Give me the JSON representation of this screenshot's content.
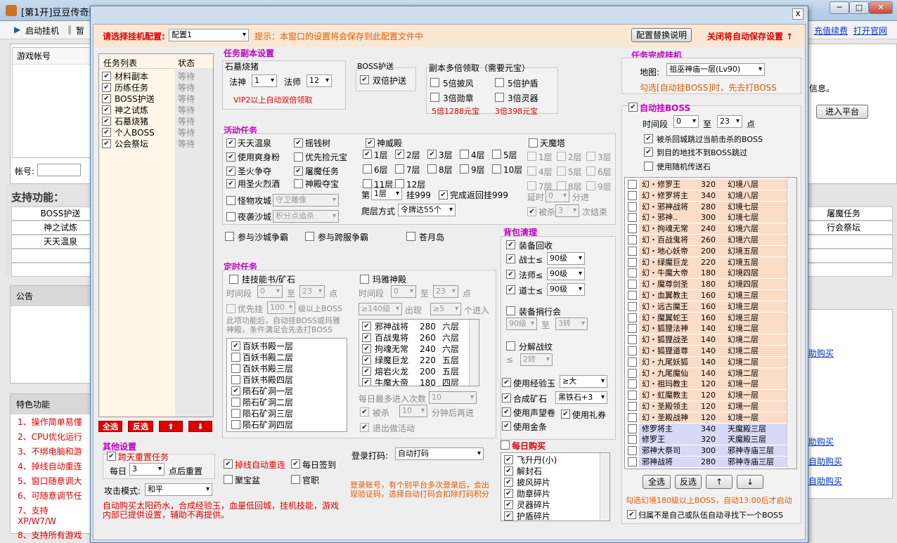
{
  "window": {
    "title": "[第1开]豆豆传奇荣",
    "btn_min": "─",
    "btn_max": "□",
    "btn_close": "✕"
  },
  "toolbar": {
    "start": "启动挂机",
    "pause": "暂",
    "renew": "充值续费",
    "official": "打开官网"
  },
  "main": {
    "account_col": "游戏帐号",
    "account_label": "帐号:",
    "info_text": "息信息。",
    "enter_btn": "进入平台",
    "support_title": "支持功能：",
    "support_cells": [
      "BOSS护送",
      "神之试炼",
      "天天温泉"
    ],
    "support_right": [
      "屠魔任务",
      "行会祭坛"
    ],
    "notice": "公告",
    "special": "特色功能",
    "special_items": [
      "1、操作简单易懂",
      "2、CPU优化运行",
      "3、不绑电脑和游",
      "4、掉线自动重连",
      "5、窗口随意调大",
      "6、可随意调节任",
      "7、支持XP/W7/W",
      "8、支持所有游戏"
    ],
    "buy_links": [
      "助购买",
      "助购买",
      "自助购买",
      "自助购买"
    ]
  },
  "dialog": {
    "close": "x",
    "config_label": "请选择挂机配置:",
    "config_value": "配置1",
    "tip": "提示：本窗口的设置将会保存到此配置文件中",
    "replace_btn": "配置替换说明",
    "close_save": "关闭将自动保存设置 ↑",
    "task_list": {
      "col_task": "任务列表",
      "col_status": "状态",
      "items": [
        {
          "name": "材料副本",
          "status": "等待"
        },
        {
          "name": "历练任务",
          "status": "等待"
        },
        {
          "name": "BOSS护送",
          "status": "等待"
        },
        {
          "name": "神之试炼",
          "status": "等待"
        },
        {
          "name": "石墓烧猪",
          "status": "等待"
        },
        {
          "name": "个人BOSS",
          "status": "等待"
        },
        {
          "name": "公会祭坛",
          "status": "等待"
        }
      ],
      "buttons": [
        "全选",
        "反选",
        "⬆",
        "⬇"
      ]
    },
    "dungeon": {
      "title": "任务副本设置",
      "sub": "石墓烧猪",
      "god_label": "法神",
      "god_value": "1",
      "mage_label": "法师",
      "mage_value": "12",
      "vip_tip": "VIP2以上自动双倍领取",
      "boss_escort": "BOSS护送",
      "double_escort": "双倍护送",
      "multi_title": "副本多倍领取（需要元宝）",
      "x5wind": "5倍披风",
      "x5shield": "5倍护盾",
      "x3medal": "3倍勋章",
      "x3spirit": "3倍灵器",
      "cost5": "5倍1288元宝",
      "cost3": "3倍398元宝"
    },
    "activity": {
      "title": "活动任务",
      "hotspring": "天天温泉",
      "moneytree": "摇钱树",
      "shenwei": "神威殿",
      "tianmo": "天魔塔",
      "shuangshen": "使用爽身粉",
      "youxian": "优先捡元宝",
      "shengzheng": "圣火争夺",
      "tumo": "屠魔任务",
      "yongshenghuo": "用圣火烈酒",
      "zhuodian": "神殿夺宝",
      "floors": [
        "1层",
        "2层",
        "3层",
        "4层",
        "5层",
        "6层",
        "7层",
        "8层",
        "9层",
        "10层",
        "11层",
        "12层"
      ],
      "tm_floors": [
        "1层",
        "2层",
        "3层",
        "4层",
        "5层",
        "6层",
        "7层",
        "8层",
        "9层"
      ],
      "layer_label": "第",
      "layer_value": "1层",
      "guaji": "挂999",
      "wancheng": "完成返回挂999",
      "pa_label": "爬层方式",
      "pa_value": "令牌达55个",
      "delay_label": "延时",
      "delay_value": "0",
      "minute": "分进",
      "killed": "被杀",
      "killed_value": "3",
      "times_end": "次结束",
      "guaiwu": "怪物攻城",
      "guaiwu_value": "守卫雕像",
      "yexi": "夜袭沙城",
      "yexi_value": "积分点追杀",
      "shacheng": "参与沙城争霸",
      "kuafu": "参与跨服争霸",
      "canglong": "苍月岛"
    },
    "timed": {
      "title": "定时任务",
      "skillbook": "挂技能书/矿石",
      "time_label": "时间段",
      "time_from": "0",
      "to": "至",
      "time_to": "23",
      "point": "点",
      "priority": "优先挂",
      "priority_value": "100",
      "level_boss": "级以上BOSS",
      "note": "此项功能后，自动挂BOSS或玛雅神殿，条件满足会先去打BOSS",
      "books": [
        {
          "n": "百妖书殿一层",
          "c": true
        },
        {
          "n": "百妖书殿二层",
          "c": false
        },
        {
          "n": "百妖书殿三层",
          "c": false
        },
        {
          "n": "百妖书殿四层",
          "c": false
        },
        {
          "n": "陨石矿洞一层",
          "c": true
        },
        {
          "n": "陨石矿洞二层",
          "c": false
        },
        {
          "n": "陨石矿洞三层",
          "c": false
        },
        {
          "n": "陨石矿洞四层",
          "c": false
        }
      ],
      "maya": "玛雅神殿",
      "maya_time_from": "0",
      "maya_time_to": "23",
      "lv_value": "≥140级",
      "appear": "出现",
      "gt_value": "≥5",
      "enter": "个进入",
      "maya_list": [
        {
          "n": "邪神战将",
          "l": "280",
          "f": "六层"
        },
        {
          "n": "百战鬼将",
          "l": "260",
          "f": "六层"
        },
        {
          "n": "拘魂无常",
          "l": "240",
          "f": "六层"
        },
        {
          "n": "绿魔巨龙",
          "l": "220",
          "f": "五层"
        },
        {
          "n": "熔岩火龙",
          "l": "200",
          "f": "五层"
        },
        {
          "n": "牛魔大帝",
          "l": "180",
          "f": "四层"
        }
      ],
      "daily_max": "每日最多进入次数",
      "daily_value": "10",
      "killed": "被杀",
      "killed_value": "10",
      "reenter": "分钟后再进",
      "exit": "退出做活动"
    },
    "bag": {
      "title": "背包清理",
      "recycle": "装备回收",
      "warrior": "战士≤",
      "warrior_v": "90级",
      "mage": "法师≤",
      "mage_v": "90级",
      "taoist": "道士≤",
      "taoist_v": "90级",
      "donate": "装备捐行会",
      "donate_from": "90级",
      "donate_to": "3转",
      "decompose": "分解战纹",
      "decompose_le": "≤",
      "decompose_v": "2转",
      "exp_jade": "使用经验玉",
      "exp_v": "≥大",
      "synth": "合成矿石",
      "synth_v": "黑铁石+3",
      "prestige": "使用声望卷",
      "gift": "使用礼券",
      "gold": "使用金条"
    },
    "daily": {
      "title": "每日购买",
      "items": [
        "飞升丹(小)",
        "解封石",
        "披风碎片",
        "勋章碎片",
        "灵器碎片",
        "护盾碎片"
      ]
    },
    "other": {
      "title": "其他设置",
      "reset": "跨天重置任务",
      "daily_label": "每日",
      "daily_value": "3",
      "reset_after": "点后重置",
      "reconnect": "掉线自动重连",
      "checkin": "每日签到",
      "jubao": "聚宝盆",
      "guanzhi": "官职",
      "login_label": "登录打码:",
      "login_value": "自动打码",
      "login_tip": "登录账号，有个别平台多次登录后，会出现验证码，选择自动打码会扣除打码积分",
      "attack_label": "攻击模式:",
      "attack_value": "和平",
      "auto_buy_tip": "自动购买太阳药水，合成经验玉，血量低回城，挂机技能，游戏内部已提供设置，辅助不再提供。"
    },
    "finish": {
      "title": "任务完成挂机",
      "map_label": "地图:",
      "map_value": "祖巫神庙一层(Lv90)",
      "tip": "勾选[自动挂BOSS]时，先去打BOSS"
    },
    "autoboss": {
      "title": "自动挂BOSS",
      "time_label": "时间段",
      "from": "0",
      "to": "至",
      "to_value": "23",
      "point": "点",
      "opt1": "被杀回城跳过当前击杀的BOSS",
      "opt2": "到目的地找不到BOSS跳过",
      "opt3": "使用随机传送石",
      "list": [
        {
          "n": "幻・修罗王",
          "l": "320",
          "m": "幻境八层",
          "t": "p"
        },
        {
          "n": "幻・修罗将主",
          "l": "340",
          "m": "幻境八层",
          "t": "p"
        },
        {
          "n": "幻・邪神战将",
          "l": "280",
          "m": "幻境七层",
          "t": "p"
        },
        {
          "n": "幻・邪神..",
          "l": "300",
          "m": "幻境七层",
          "t": "p"
        },
        {
          "n": "幻・拘魂无常",
          "l": "240",
          "m": "幻境六层",
          "t": "p"
        },
        {
          "n": "幻・百战鬼将",
          "l": "260",
          "m": "幻境六层",
          "t": "p"
        },
        {
          "n": "幻・地心妖帝",
          "l": "200",
          "m": "幻境五层",
          "t": "p"
        },
        {
          "n": "幻・绿魔巨龙",
          "l": "220",
          "m": "幻境五层",
          "t": "p"
        },
        {
          "n": "幻・牛魔大帝",
          "l": "180",
          "m": "幻境四层",
          "t": "p"
        },
        {
          "n": "幻・魔尊剑圣",
          "l": "180",
          "m": "幻境四层",
          "t": "p"
        },
        {
          "n": "幻・血翼教主",
          "l": "160",
          "m": "幻境三层",
          "t": "p"
        },
        {
          "n": "幻・远古魔王",
          "l": "160",
          "m": "幻境三层",
          "t": "p"
        },
        {
          "n": "幻・魔翼蛇王",
          "l": "160",
          "m": "幻境三层",
          "t": "p"
        },
        {
          "n": "幻・狐狸法神",
          "l": "140",
          "m": "幻境二层",
          "t": "p"
        },
        {
          "n": "幻・狐狸战圣",
          "l": "140",
          "m": "幻境二层",
          "t": "p"
        },
        {
          "n": "幻・狐狸道尊",
          "l": "140",
          "m": "幻境二层",
          "t": "p"
        },
        {
          "n": "幻・九尾妖狐",
          "l": "140",
          "m": "幻境二层",
          "t": "p"
        },
        {
          "n": "幻・九尾魔仙",
          "l": "140",
          "m": "幻境二层",
          "t": "p"
        },
        {
          "n": "幻・祖玛教主",
          "l": "120",
          "m": "幻境一层",
          "t": "p"
        },
        {
          "n": "幻・虹魔教主",
          "l": "120",
          "m": "幻境一层",
          "t": "p"
        },
        {
          "n": "幻・圣殿领主",
          "l": "120",
          "m": "幻境一层",
          "t": "p"
        },
        {
          "n": "幻・圣殿战神",
          "l": "120",
          "m": "幻境一层",
          "t": "p"
        },
        {
          "n": "修罗将主",
          "l": "340",
          "m": "天魔殿三层",
          "t": "l"
        },
        {
          "n": "修罗王",
          "l": "320",
          "m": "天魔殿三层",
          "t": "l"
        },
        {
          "n": "邪神大祭司",
          "l": "300",
          "m": "邪神寺庙三层",
          "t": "l"
        },
        {
          "n": "邪神战将",
          "l": "280",
          "m": "邪神寺庙三层",
          "t": "l"
        }
      ],
      "buttons": [
        "全选",
        "反选",
        "↑",
        "↓"
      ],
      "tip": "勾选幻境180级以上BOSS，自动13:00后才启动",
      "return": "归属不是自己或队伍自动寻找下一个BOSS"
    }
  },
  "colors": {
    "magenta": "#c000c0",
    "red": "#e00000",
    "orange": "#e25a00",
    "pink": "#fbdcc8",
    "lavender": "#d8d8f8"
  }
}
